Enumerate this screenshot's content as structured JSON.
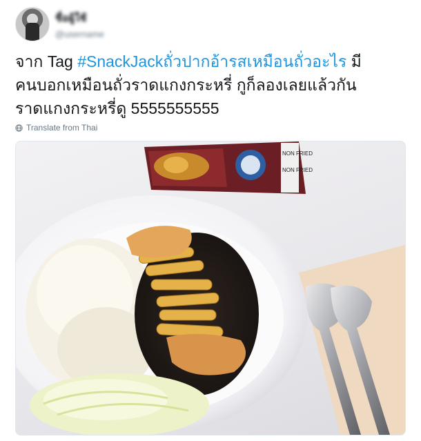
{
  "tweet": {
    "author_name": "ชื่อผู้ใช้",
    "author_handle": "@username",
    "text_prefix": "จาก Tag ",
    "hashtag": "#SnackJackถั่วปากอ้ารสเหมือนถั่วอะไร",
    "text_line1_suffix": " มี",
    "text_line2": "คนบอกเหมือนถั่วราดแกงกระหรี่ กูก็ลองเลยแล้วกัน",
    "text_line3": "ราดแกงกระหรี่ดู 5555555555",
    "translate_label": "Translate from Thai"
  },
  "photo": {
    "snack_bag_text": "NON FRIED"
  },
  "colors": {
    "hashtag": "#1b95e0",
    "text": "#14171a",
    "muted": "#657786"
  }
}
